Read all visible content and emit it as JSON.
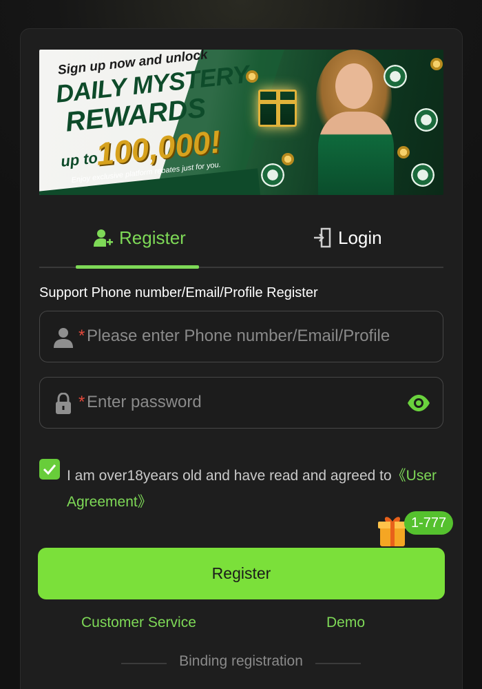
{
  "banner": {
    "line1": "Sign up now and unlock",
    "line2": "DAILY MYSTERY",
    "line3": "REWARDS",
    "upto": "up to",
    "amount": "100,000!",
    "tagline": "Enjoy exclusive platform rebates just for you."
  },
  "tabs": [
    {
      "label": "Register",
      "icon": "add-user-icon",
      "active": true
    },
    {
      "label": "Login",
      "icon": "login-door-icon",
      "active": false
    }
  ],
  "form": {
    "support_label": "Support Phone number/Email/Profile Register",
    "phone_required_mark": "*",
    "phone_placeholder": "Please enter Phone number/Email/Profile",
    "password_required_mark": "*",
    "password_placeholder": "Enter password",
    "agree_checked": true,
    "agree_text": "I am over18years old and have read and agreed to",
    "agree_link": "《User Agreement》",
    "bonus_badge": "1-777",
    "register_button": "Register"
  },
  "footer": {
    "customer_service": "Customer Service",
    "demo": "Demo",
    "binding": "Binding registration"
  },
  "colors": {
    "accent": "#7ed957",
    "button": "#7be03a",
    "background": "#121212",
    "card": "#1e1e1e",
    "required": "#e5493b"
  }
}
